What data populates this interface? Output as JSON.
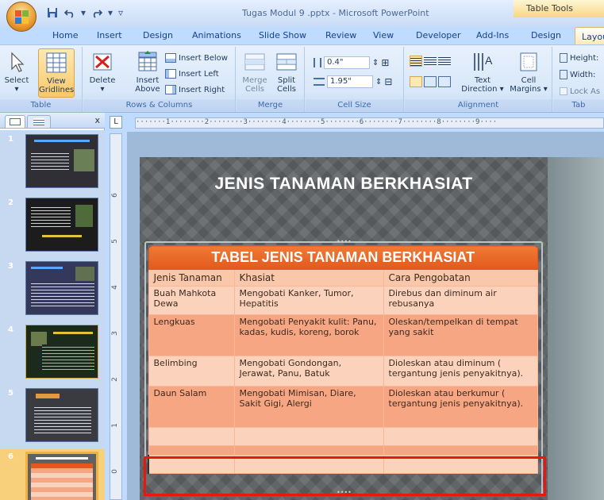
{
  "window": {
    "title": "Tugas Modul 9 .pptx - Microsoft PowerPoint",
    "contextual_tab_title": "Table Tools"
  },
  "tabs": [
    "Home",
    "Insert",
    "Design",
    "Animations",
    "Slide Show",
    "Review",
    "View",
    "Developer",
    "Add-Ins",
    "Design",
    "Layou"
  ],
  "active_tab_index": 10,
  "ribbon": {
    "table_group": {
      "label": "Table",
      "select": "Select",
      "view_gridlines_1": "View",
      "view_gridlines_2": "Gridlines"
    },
    "rows_columns_group": {
      "label": "Rows & Columns",
      "delete": "Delete",
      "insert_above_1": "Insert",
      "insert_above_2": "Above",
      "insert_below": "Insert Below",
      "insert_left": "Insert Left",
      "insert_right": "Insert Right"
    },
    "merge_group": {
      "label": "Merge",
      "merge_1": "Merge",
      "merge_2": "Cells",
      "split_1": "Split",
      "split_2": "Cells"
    },
    "cell_size_group": {
      "label": "Cell Size",
      "height_value": "0.4\"",
      "width_value": "1.95\""
    },
    "alignment_group": {
      "label": "Alignment",
      "text_direction_1": "Text",
      "text_direction_2": "Direction",
      "cell_margins_1": "Cell",
      "cell_margins_2": "Margins"
    },
    "table_size_group": {
      "label": "Tab",
      "height": "Height:",
      "width": "Width:",
      "lock": "Lock As"
    }
  },
  "slides": [
    {
      "number": "1"
    },
    {
      "number": "2"
    },
    {
      "number": "3"
    },
    {
      "number": "4"
    },
    {
      "number": "5"
    },
    {
      "number": "6"
    }
  ],
  "ruler": {
    "horizontal": "·······1········2········3········4········5········6········7········8········9····",
    "vertical": [
      "6",
      "5",
      "4",
      "3",
      "2",
      "1",
      "0"
    ]
  },
  "slide": {
    "title": "JENIS TANAMAN BERKHASIAT",
    "table": {
      "caption": "TABEL JENIS TANAMAN BERKHASIAT",
      "headers": [
        "Jenis Tanaman",
        "Khasiat",
        "Cara Pengobatan"
      ],
      "rows": [
        [
          "Buah Mahkota Dewa",
          "Mengobati Kanker, Tumor, Hepatitis",
          "Direbus dan diminum air rebusanya"
        ],
        [
          "Lengkuas",
          "Mengobati Penyakit kulit: Panu, kadas, kudis, koreng, borok",
          "Oleskan/tempelkan di tempat yang sakit"
        ],
        [
          "Belimbing",
          "Mengobati  Gondongan, Jerawat, Panu, Batuk",
          "Dioleskan atau diminum ( tergantung jenis penyakitnya)."
        ],
        [
          "Daun Salam",
          "Mengobati Mimisan, Diare, Sakit Gigi, Alergi",
          "Dioleskan atau berkumur ( tergantung jenis penyakitnya)."
        ],
        [
          "",
          "",
          ""
        ],
        [
          "",
          "",
          ""
        ],
        [
          "",
          "",
          ""
        ]
      ]
    }
  },
  "colors": {
    "table_header": "#e3591c",
    "row_light": "#fbd3bd",
    "row_dark": "#f6a683",
    "highlight": "#e8170f"
  }
}
